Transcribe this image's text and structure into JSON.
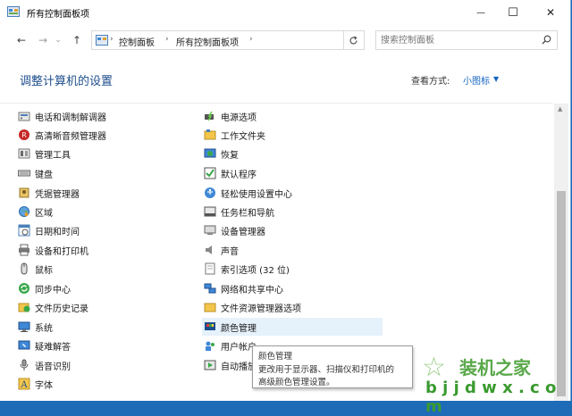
{
  "window": {
    "title": "所有控制面板项",
    "controls": {
      "minimize": "—",
      "maximize": "☐",
      "close": "✕"
    }
  },
  "nav": {
    "back": "←",
    "forward": "→",
    "dropdown": "⌄",
    "up": "↑",
    "breadcrumb": [
      "控制面板",
      "所有控制面板项"
    ],
    "separator": "›",
    "search_placeholder": "搜索控制面板"
  },
  "main": {
    "heading": "调整计算机的设置",
    "view_by_label": "查看方式:",
    "view_by_value": "小图标",
    "col1": [
      {
        "label": "电话和调制解调器",
        "icon": "phone-modem-icon"
      },
      {
        "label": "高清晰音频管理器",
        "icon": "audio-manager-icon"
      },
      {
        "label": "管理工具",
        "icon": "admin-tools-icon"
      },
      {
        "label": "键盘",
        "icon": "keyboard-icon"
      },
      {
        "label": "凭据管理器",
        "icon": "credential-icon"
      },
      {
        "label": "区域",
        "icon": "region-icon"
      },
      {
        "label": "日期和时间",
        "icon": "datetime-icon"
      },
      {
        "label": "设备和打印机",
        "icon": "printer-icon"
      },
      {
        "label": "鼠标",
        "icon": "mouse-icon"
      },
      {
        "label": "同步中心",
        "icon": "sync-icon"
      },
      {
        "label": "文件历史记录",
        "icon": "file-history-icon"
      },
      {
        "label": "系统",
        "icon": "system-icon"
      },
      {
        "label": "疑难解答",
        "icon": "troubleshoot-icon"
      },
      {
        "label": "语音识别",
        "icon": "microphone-icon"
      },
      {
        "label": "字体",
        "icon": "font-icon"
      }
    ],
    "col2": [
      {
        "label": "电源选项",
        "icon": "power-icon"
      },
      {
        "label": "工作文件夹",
        "icon": "work-folder-icon"
      },
      {
        "label": "恢复",
        "icon": "recovery-icon"
      },
      {
        "label": "默认程序",
        "icon": "default-programs-icon"
      },
      {
        "label": "轻松使用设置中心",
        "icon": "ease-of-access-icon"
      },
      {
        "label": "任务栏和导航",
        "icon": "taskbar-icon"
      },
      {
        "label": "设备管理器",
        "icon": "device-manager-icon"
      },
      {
        "label": "声音",
        "icon": "speaker-icon"
      },
      {
        "label": "索引选项 (32 位)",
        "icon": "index-icon"
      },
      {
        "label": "网络和共享中心",
        "icon": "network-icon"
      },
      {
        "label": "文件资源管理器选项",
        "icon": "folder-options-icon"
      },
      {
        "label": "颜色管理",
        "icon": "color-management-icon"
      },
      {
        "label": "用户帐户",
        "icon": "user-accounts-icon"
      },
      {
        "label": "自动播放",
        "icon": "autoplay-icon"
      }
    ]
  },
  "tooltip": {
    "title": "颜色管理",
    "line1": "更改用于显示器、扫描仪和打印机的",
    "line2": "高级颜色管理设置。"
  },
  "watermark": {
    "line1": "装机之家",
    "line2": "b j j d w x . c o m"
  },
  "colors": {
    "heading": "#1e4e8c",
    "link": "#1565c0",
    "hover": "#e5f1fb",
    "desktop": "#1e6bb8"
  }
}
